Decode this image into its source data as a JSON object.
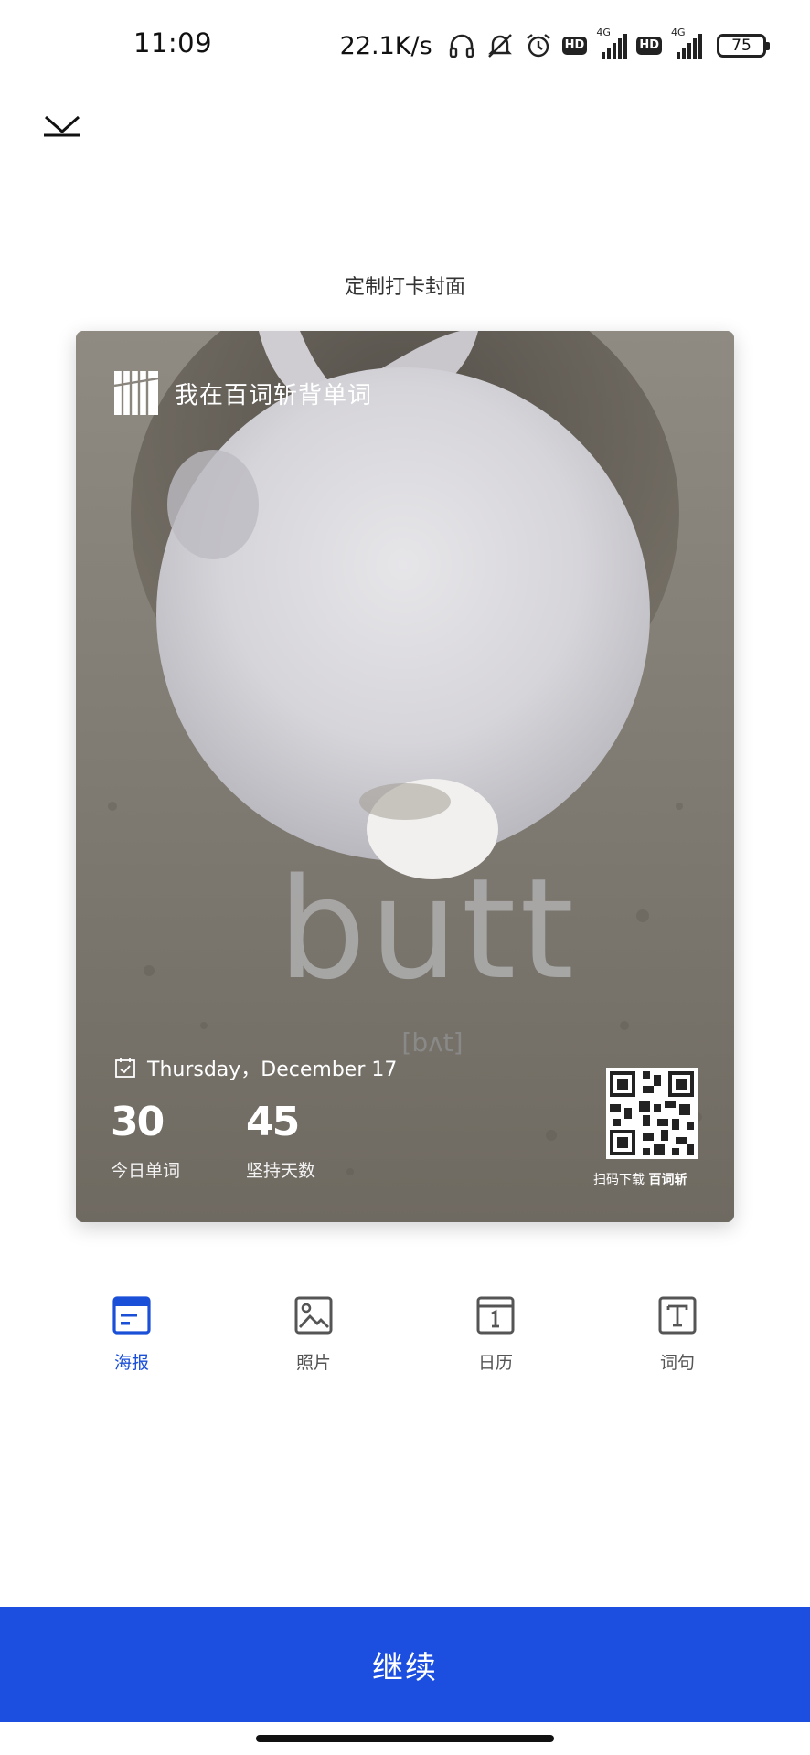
{
  "status_bar": {
    "time": "11:09",
    "net_speed": "22.1K/s",
    "hd_label": "HD",
    "network_type": "4G",
    "battery": "75",
    "icons": [
      "headphones-icon",
      "mute-icon",
      "alarm-icon",
      "hd-icon",
      "signal-icon",
      "hd-icon",
      "signal-icon",
      "battery-icon"
    ]
  },
  "header": {
    "collapse_icon": "chevron-down-icon",
    "title": "定制打卡封面"
  },
  "poster": {
    "brand_text": "我在百词斩背单词",
    "word": "butt",
    "phonetic": "[bʌt]",
    "date": "Thursday，December 17",
    "stats": [
      {
        "value": "30",
        "label": "今日单词"
      },
      {
        "value": "45",
        "label": "坚持天数"
      }
    ],
    "qr_caption_prefix": "扫码下载",
    "qr_caption_brand": "百词斩"
  },
  "tabs": [
    {
      "label": "海报",
      "icon": "poster-icon",
      "active": true
    },
    {
      "label": "照片",
      "icon": "photo-icon",
      "active": false
    },
    {
      "label": "日历",
      "icon": "calendar-icon",
      "active": false
    },
    {
      "label": "词句",
      "icon": "text-icon",
      "active": false
    }
  ],
  "continue_label": "继续",
  "colors": {
    "accent": "#1c4fe0",
    "active_tab": "#1a4fd8",
    "inactive_tab": "#555555"
  }
}
